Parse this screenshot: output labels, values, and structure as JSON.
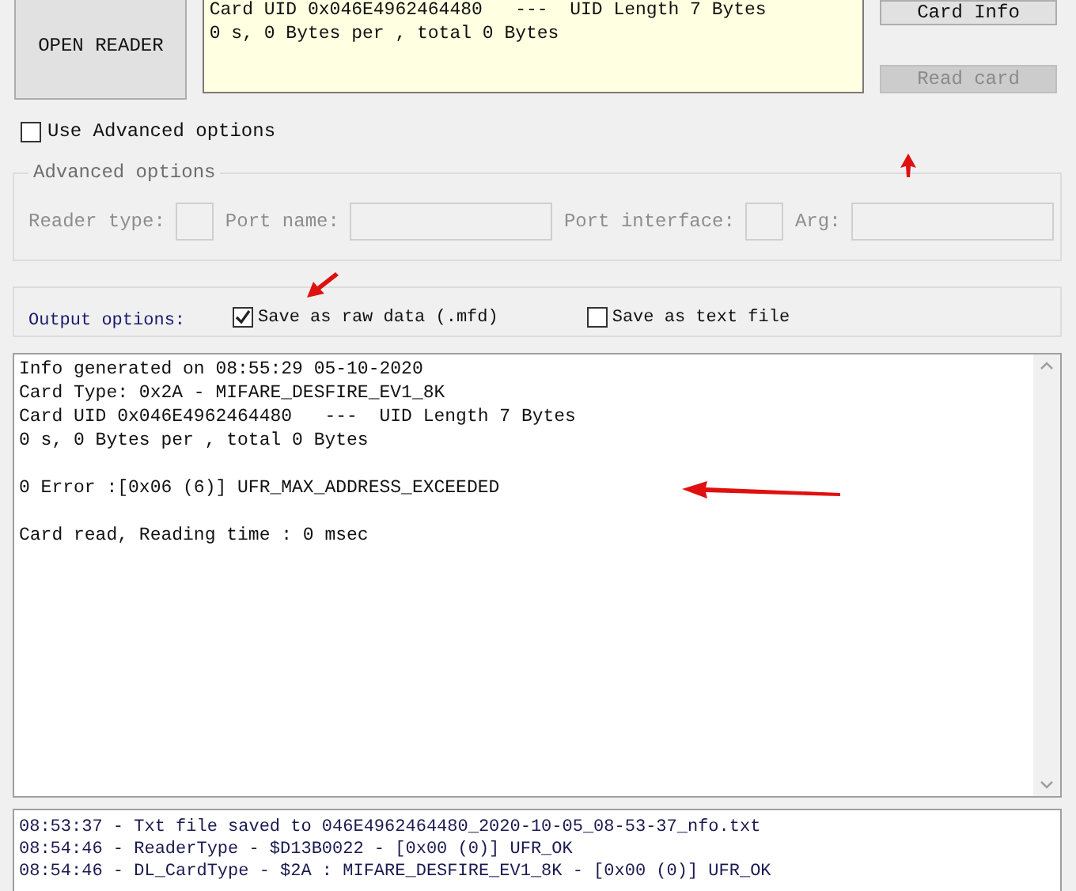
{
  "open_reader_button": {
    "label": "OPEN READER"
  },
  "info_box": {
    "lines": [
      "Card UID 0x046E4962464480   ---  UID Length 7 Bytes",
      "0 s, 0 Bytes per , total 0 Bytes"
    ]
  },
  "card_info_button": {
    "label": "Card Info",
    "disabled": false
  },
  "read_card_button": {
    "label": "Read card",
    "disabled": true
  },
  "advanced_checkbox": {
    "label": "Use Advanced options",
    "checked": false
  },
  "advanced_options": {
    "title": "Advanced options",
    "disabled": true,
    "fields": [
      {
        "label": "Reader type:",
        "kind": "small"
      },
      {
        "label": "Port name:",
        "kind": "wide"
      },
      {
        "label": "Port interface:",
        "kind": "small"
      },
      {
        "label": "Arg:",
        "kind": "wide"
      }
    ]
  },
  "output_options": {
    "label": "Output options:",
    "options": [
      {
        "label": "Save as raw data (.mfd)",
        "checked": true
      },
      {
        "label": "Save as text file",
        "checked": false
      }
    ]
  },
  "output_blocks": [
    [
      "Info generated on 08:55:29 05-10-2020",
      "Card Type: 0x2A - MIFARE_DESFIRE_EV1_8K",
      "Card UID 0x046E4962464480   ---  UID Length 7 Bytes",
      "0 s, 0 Bytes per , total 0 Bytes"
    ],
    [
      "0 Error :[0x06 (6)] UFR_MAX_ADDRESS_EXCEEDED"
    ],
    [
      "Card read, Reading time : 0 msec"
    ]
  ],
  "log_lines": [
    "08:53:37 - Txt file saved to 046E4962464480_2020-10-05_08-53-37_nfo.txt",
    "08:54:46 - ReaderType - $D13B0022 - [0x00 (0)] UFR_OK",
    "08:54:46 - DL_CardType - $2A : MIFARE_DESFIRE_EV1_8K - [0x00 (0)] UFR_OK"
  ]
}
